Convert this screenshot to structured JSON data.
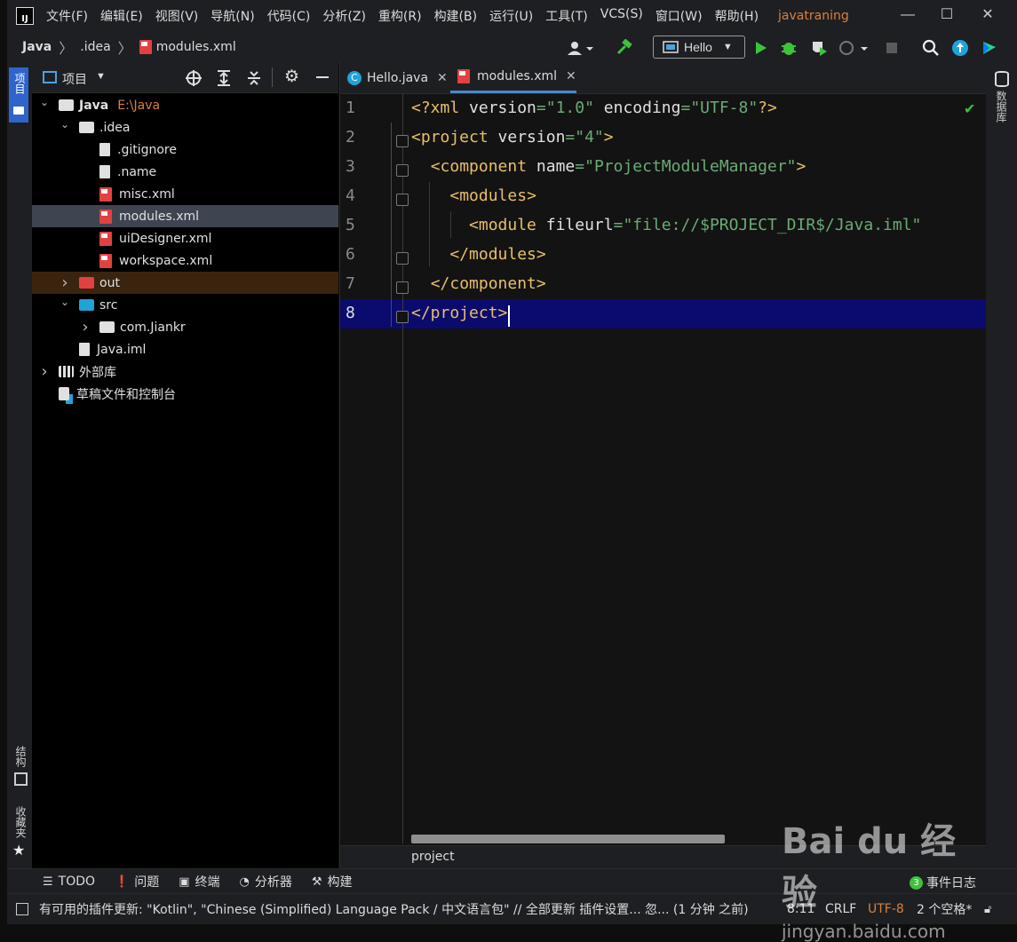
{
  "menu": {
    "items": [
      "文件(F)",
      "编辑(E)",
      "视图(V)",
      "导航(N)",
      "代码(C)",
      "分析(Z)",
      "重构(R)",
      "构建(B)",
      "运行(U)",
      "工具(T)",
      "VCS(S)",
      "窗口(W)",
      "帮助(H)"
    ],
    "project_title": "javatraning",
    "app_icon_text": "IJ"
  },
  "window": {
    "minimize": "—",
    "maximize": "☐",
    "close": "✕"
  },
  "breadcrumb": {
    "root": "Java",
    "folder": ".idea",
    "file": "modules.xml"
  },
  "run": {
    "config": "Hello"
  },
  "left_strip": {
    "project_tab": "项目",
    "structure_tab": "结构",
    "favorites_tab": "收藏夹"
  },
  "right_strip": {
    "database_tab": "数据库"
  },
  "project_panel": {
    "title": "项目",
    "tree": [
      {
        "label": "Java",
        "extra": "E:\\Java",
        "indent": 0,
        "chev": "down",
        "kind": "module"
      },
      {
        "label": ".idea",
        "indent": 1,
        "chev": "down",
        "kind": "folder-white"
      },
      {
        "label": ".gitignore",
        "indent": 2,
        "kind": "gitignore"
      },
      {
        "label": ".name",
        "indent": 2,
        "kind": "text"
      },
      {
        "label": "misc.xml",
        "indent": 2,
        "kind": "xml"
      },
      {
        "label": "modules.xml",
        "indent": 2,
        "kind": "xml",
        "selected": true
      },
      {
        "label": "uiDesigner.xml",
        "indent": 2,
        "kind": "xml"
      },
      {
        "label": "workspace.xml",
        "indent": 2,
        "kind": "xml"
      },
      {
        "label": "out",
        "indent": 1,
        "chev": "right",
        "kind": "folder-red",
        "highlight": true
      },
      {
        "label": "src",
        "indent": 1,
        "chev": "down",
        "kind": "folder-blue"
      },
      {
        "label": "com.Jiankr",
        "indent": 2,
        "chev": "right",
        "kind": "package"
      },
      {
        "label": "Java.iml",
        "indent": 1,
        "kind": "iml"
      },
      {
        "label": "外部库",
        "indent": 0,
        "chev": "right",
        "kind": "library"
      },
      {
        "label": "草稿文件和控制台",
        "indent": 0,
        "kind": "scratch"
      }
    ]
  },
  "editor": {
    "tabs": [
      {
        "label": "Hello.java",
        "active": false
      },
      {
        "label": "modules.xml",
        "active": true
      }
    ],
    "lines": [
      "<?xml version=\"1.0\" encoding=\"UTF-8\"?>",
      "<project version=\"4\">",
      "  <component name=\"ProjectModuleManager\">",
      "    <modules>",
      "      <module fileurl=\"file://$PROJECT_DIR$/Java.iml\"",
      "    </modules>",
      "  </component>",
      "</project>"
    ],
    "line_numbers": [
      "1",
      "2",
      "3",
      "4",
      "5",
      "6",
      "7",
      "8"
    ],
    "current_line": 8,
    "status_crumb": "project"
  },
  "bottom_tools": [
    {
      "icon": "list-icon",
      "label": "TODO"
    },
    {
      "icon": "alert-icon",
      "label": "问题"
    },
    {
      "icon": "terminal-icon",
      "label": "终端"
    },
    {
      "icon": "profiler-icon",
      "label": "分析器"
    },
    {
      "icon": "hammer-icon",
      "label": "构建"
    }
  ],
  "event_log": {
    "count": "3",
    "label": "事件日志"
  },
  "status": {
    "message": "有可用的插件更新: \"Kotlin\", \"Chinese (Simplified) Language Pack / 中文语言包\" // 全部更新   插件设置...   忽... (1 分钟 之前)",
    "position": "8:11",
    "line_sep": "CRLF",
    "encoding": "UTF-8",
    "indent": "2 个空格*"
  },
  "watermark": {
    "brand": "Bai du 经验",
    "url": "jingyan.baidu.com"
  },
  "colors": {
    "accent": "#d9803c",
    "run_green": "#3cc33c",
    "xml_red": "#e24141",
    "selection": "#3e4450",
    "current_line": "#0b0b6e"
  }
}
